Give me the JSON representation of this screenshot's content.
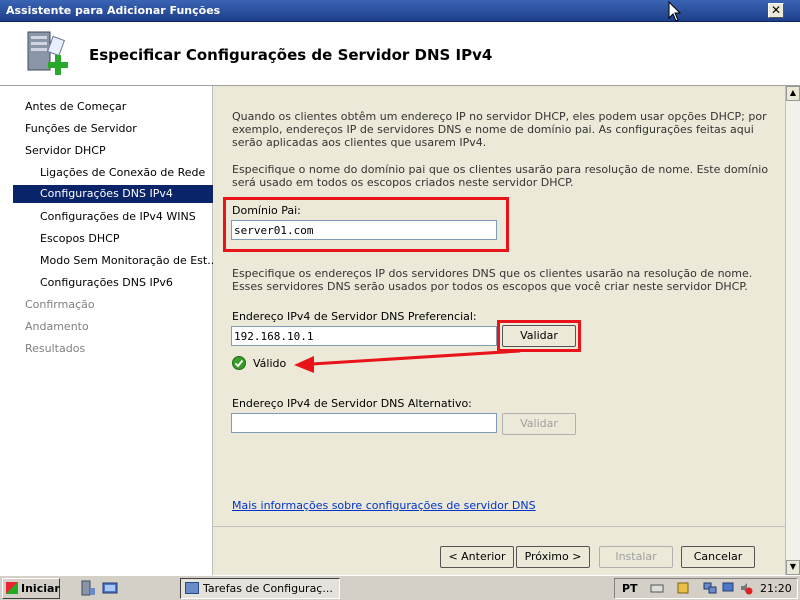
{
  "window": {
    "title": "Assistente para Adicionar Funções",
    "close_label": "✕"
  },
  "header": {
    "title": "Especificar Configurações de Servidor DNS IPv4"
  },
  "nav": {
    "items": [
      {
        "label": "Antes de Começar",
        "state": "normal"
      },
      {
        "label": "Funções de Servidor",
        "state": "normal"
      },
      {
        "label": "Servidor DHCP",
        "state": "normal"
      },
      {
        "label": "Ligações de Conexão de Rede",
        "state": "sub"
      },
      {
        "label": "Configurações DNS IPv4",
        "state": "selected"
      },
      {
        "label": "Configurações de IPv4 WINS",
        "state": "sub"
      },
      {
        "label": "Escopos DHCP",
        "state": "sub"
      },
      {
        "label": "Modo Sem Monitoração de Est...",
        "state": "sub"
      },
      {
        "label": "Configurações DNS IPv6",
        "state": "sub"
      },
      {
        "label": "Confirmação",
        "state": "disabled"
      },
      {
        "label": "Andamento",
        "state": "disabled"
      },
      {
        "label": "Resultados",
        "state": "disabled"
      }
    ]
  },
  "content": {
    "intro": "Quando os clientes obtêm um endereço IP no servidor DHCP, eles podem usar opções DHCP; por exemplo, endereços IP de servidores DNS e nome de domínio pai. As configurações feitas aqui serão aplicadas aos clientes que usarem IPv4.",
    "domain_desc": "Especifique o nome do domínio pai que os clientes usarão para resolução de nome. Este domínio será usado em todos os escopos criados neste servidor DHCP.",
    "domain_label": "Domínio Pai:",
    "domain_value": "server01.com",
    "dns_desc": "Especifique os endereços IP dos servidores DNS que os clientes usarão na resolução de nome. Esses servidores DNS serão usados por todos os escopos que você criar neste servidor DHCP.",
    "preferred_label": "Endereço IPv4 de Servidor DNS Preferencial:",
    "preferred_value": "192.168.10.1",
    "validate_label": "Validar",
    "valid_text": "Válido",
    "alternate_label": "Endereço IPv4 de Servidor DNS Alternativo:",
    "alternate_value": "",
    "validate_alt_label": "Validar",
    "more_info_link": "Mais informações sobre configurações de servidor DNS"
  },
  "footer": {
    "back_label": "< Anterior",
    "next_label": "Próximo >",
    "install_label": "Instalar",
    "cancel_label": "Cancelar"
  },
  "taskbar": {
    "start_label": "Iniciar",
    "task_label": "Tarefas de Configuraç...",
    "lang": "PT",
    "clock": "21:20"
  },
  "colors": {
    "highlight": "#e8141a",
    "selected_nav": "#0a246a",
    "link": "#0033cc"
  }
}
